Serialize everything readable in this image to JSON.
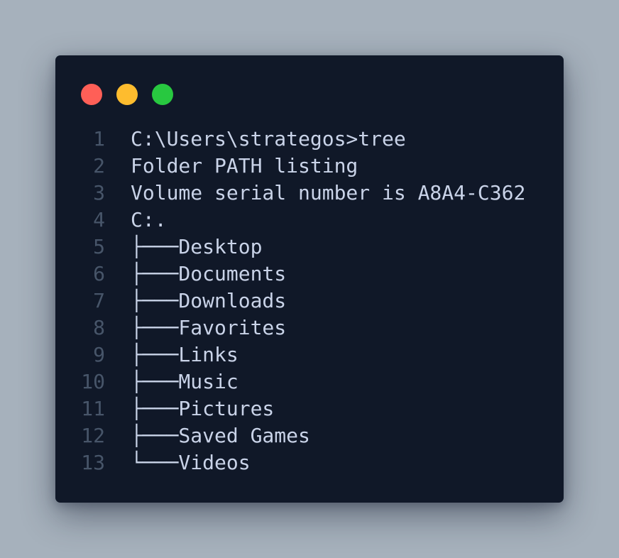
{
  "colors": {
    "page_background": "#a6b1bc",
    "terminal_background": "#101828",
    "text": "#c9d3e8",
    "line_number": "#475569",
    "close": "#ff5f57",
    "minimize": "#febc2e",
    "maximize": "#28c840"
  },
  "window_controls": [
    {
      "name": "close",
      "color": "#ff5f57"
    },
    {
      "name": "minimize",
      "color": "#febc2e"
    },
    {
      "name": "maximize",
      "color": "#28c840"
    }
  ],
  "code": {
    "lines": [
      {
        "number": "1",
        "text": "C:\\Users\\strategos>tree"
      },
      {
        "number": "2",
        "text": "Folder PATH listing"
      },
      {
        "number": "3",
        "text": "Volume serial number is A8A4-C362"
      },
      {
        "number": "4",
        "text": "C:."
      },
      {
        "number": "5",
        "text": "├───Desktop"
      },
      {
        "number": "6",
        "text": "├───Documents"
      },
      {
        "number": "7",
        "text": "├───Downloads"
      },
      {
        "number": "8",
        "text": "├───Favorites"
      },
      {
        "number": "9",
        "text": "├───Links"
      },
      {
        "number": "10",
        "text": "├───Music"
      },
      {
        "number": "11",
        "text": "├───Pictures"
      },
      {
        "number": "12",
        "text": "├───Saved Games"
      },
      {
        "number": "13",
        "text": "└───Videos"
      }
    ]
  }
}
